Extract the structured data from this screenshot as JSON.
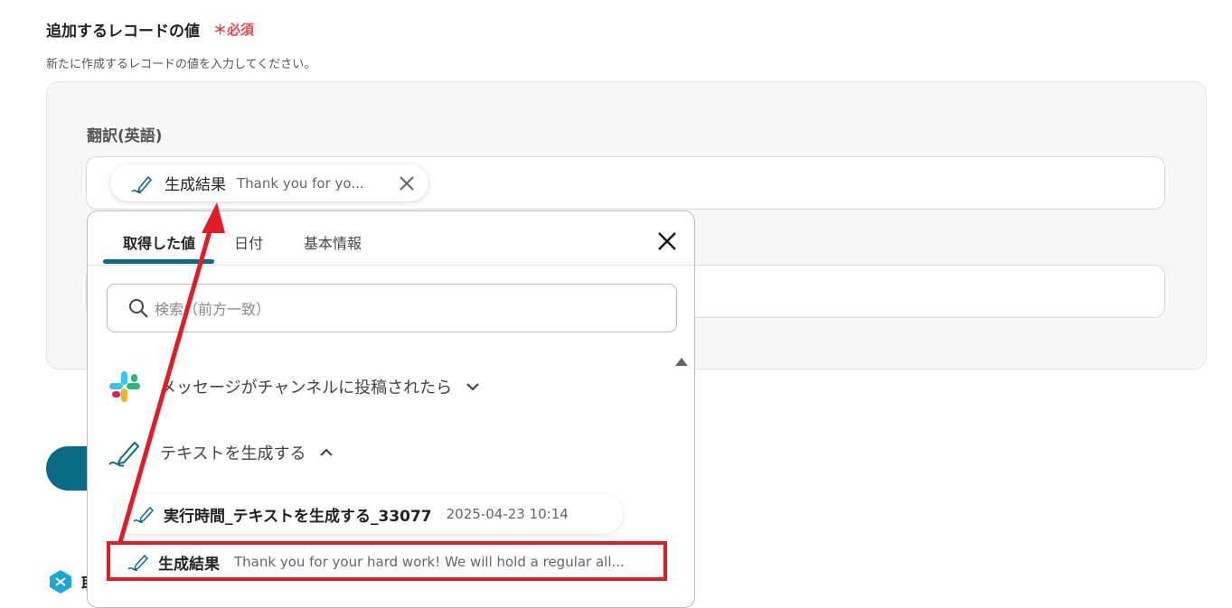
{
  "section": {
    "title": "追加するレコードの値",
    "required_label": "＊必須",
    "description": "新たに作成するレコードの値を入力してください。"
  },
  "field": {
    "label": "翻訳(英語)",
    "chip": {
      "label": "生成結果",
      "value": "Thank you for yo..."
    }
  },
  "popup": {
    "tabs": [
      {
        "label": "取得した値",
        "active": true
      },
      {
        "label": "日付",
        "active": false
      },
      {
        "label": "基本情報",
        "active": false
      }
    ],
    "search_placeholder": "検索（前方一致）",
    "groups": [
      {
        "label": "メッセージがチャンネルに投稿されたら",
        "icon": "slack-icon",
        "expanded": false
      },
      {
        "label": "テキストを生成する",
        "icon": "pen-icon",
        "expanded": true
      }
    ],
    "items": [
      {
        "label": "実行時間_テキストを生成する_33077",
        "value": "2025-04-23 10:14"
      },
      {
        "label": "生成結果",
        "value": "Thank you for your hard work! We will hold a regular all..."
      }
    ]
  },
  "background": {
    "partial_text": "取"
  },
  "colors": {
    "accent": "#0b6a86",
    "required": "#e5484d",
    "annotation": "#e31b23"
  }
}
